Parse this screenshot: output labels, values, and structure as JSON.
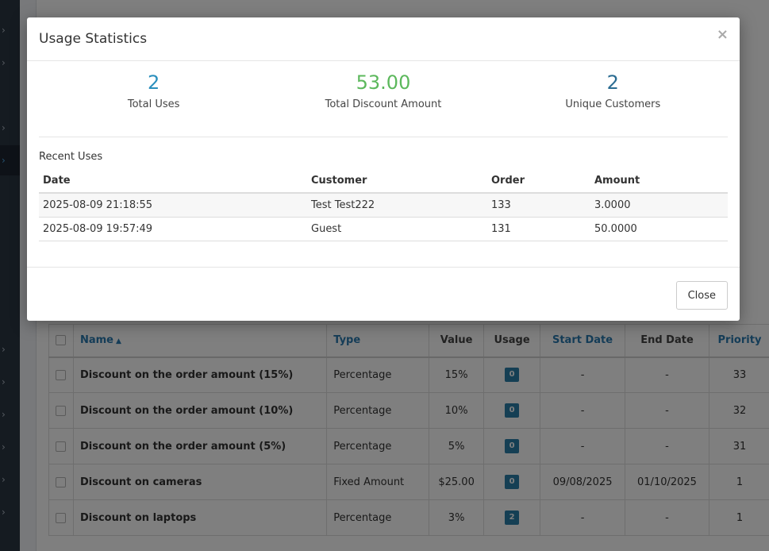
{
  "modal": {
    "title": "Usage Statistics",
    "close_icon": "close-icon",
    "close_glyph": "×",
    "stats": [
      {
        "value": "2",
        "label": "Total Uses",
        "color": "#2a8fbd"
      },
      {
        "value": "53.00",
        "label": "Total Discount Amount",
        "color": "#5cb85c"
      },
      {
        "value": "2",
        "label": "Unique Customers",
        "color": "#2b6c92"
      }
    ],
    "recent_label": "Recent Uses",
    "uses_table": {
      "columns": [
        "Date",
        "Customer",
        "Order",
        "Amount"
      ],
      "rows": [
        [
          "2025-08-09 21:18:55",
          "Test Test222",
          "133",
          "3.0000"
        ],
        [
          "2025-08-09 19:57:49",
          "Guest",
          "131",
          "50.0000"
        ]
      ]
    },
    "footer": {
      "close_label": "Close"
    }
  },
  "background_table": {
    "columns": [
      "Name",
      "Type",
      "Value",
      "Usage",
      "Start Date",
      "End Date",
      "Priority"
    ],
    "sort_icon": "sort-ascending-icon",
    "rows": [
      {
        "name": "Discount on the order amount (15%)",
        "type": "Percentage",
        "value": "15%",
        "usage": "0",
        "start": "-",
        "end": "-",
        "priority": "33"
      },
      {
        "name": "Discount on the order amount (10%)",
        "type": "Percentage",
        "value": "10%",
        "usage": "0",
        "start": "-",
        "end": "-",
        "priority": "32"
      },
      {
        "name": "Discount on the order amount (5%)",
        "type": "Percentage",
        "value": "5%",
        "usage": "0",
        "start": "-",
        "end": "-",
        "priority": "31"
      },
      {
        "name": "Discount on cameras",
        "type": "Fixed Amount",
        "value": "$25.00",
        "usage": "0",
        "start": "09/08/2025",
        "end": "01/10/2025",
        "priority": "1"
      },
      {
        "name": "Discount on laptops",
        "type": "Percentage",
        "value": "3%",
        "usage": "2",
        "start": "-",
        "end": "-",
        "priority": "1"
      }
    ]
  },
  "sidebar": {
    "arrow_icon": "chevron-right-icon",
    "arrow_glyph": "›"
  }
}
